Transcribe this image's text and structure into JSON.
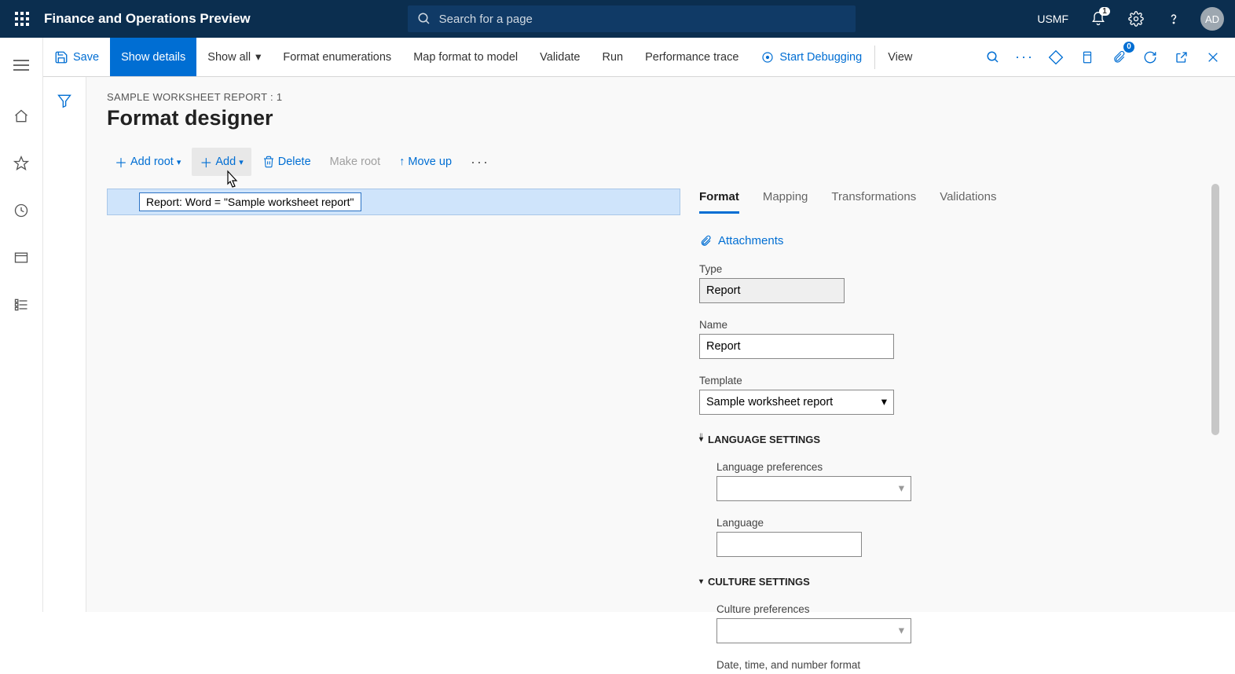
{
  "topbar": {
    "app_title": "Finance and Operations Preview",
    "search_placeholder": "Search for a page",
    "company": "USMF",
    "notification_badge": "1",
    "avatar_initials": "AD"
  },
  "ribbon": {
    "save": "Save",
    "show_details": "Show details",
    "show_all": "Show all",
    "format_enum": "Format enumerations",
    "map_format": "Map format to model",
    "validate": "Validate",
    "run": "Run",
    "perf_trace": "Performance trace",
    "start_debug": "Start Debugging",
    "view": "View",
    "badge_count": "0"
  },
  "page": {
    "breadcrumb": "SAMPLE WORKSHEET REPORT : 1",
    "title": "Format designer"
  },
  "toolbar": {
    "add_root": "Add root",
    "add": "Add",
    "delete": "Delete",
    "make_root": "Make root",
    "move_up": "Move up"
  },
  "tree": {
    "node": "Report: Word = \"Sample worksheet report\""
  },
  "right": {
    "tabs": {
      "format": "Format",
      "mapping": "Mapping",
      "transformations": "Transformations",
      "validations": "Validations"
    },
    "attachments": "Attachments",
    "type_label": "Type",
    "type_value": "Report",
    "name_label": "Name",
    "name_value": "Report",
    "template_label": "Template",
    "template_value": "Sample worksheet report",
    "lang_section": "LANGUAGE SETTINGS",
    "lang_pref_label": "Language preferences",
    "lang_pref_value": "",
    "lang_label": "Language",
    "lang_value": "",
    "culture_section": "CULTURE SETTINGS",
    "culture_pref_label": "Culture preferences",
    "culture_pref_value": "",
    "date_label": "Date, time, and number format"
  }
}
